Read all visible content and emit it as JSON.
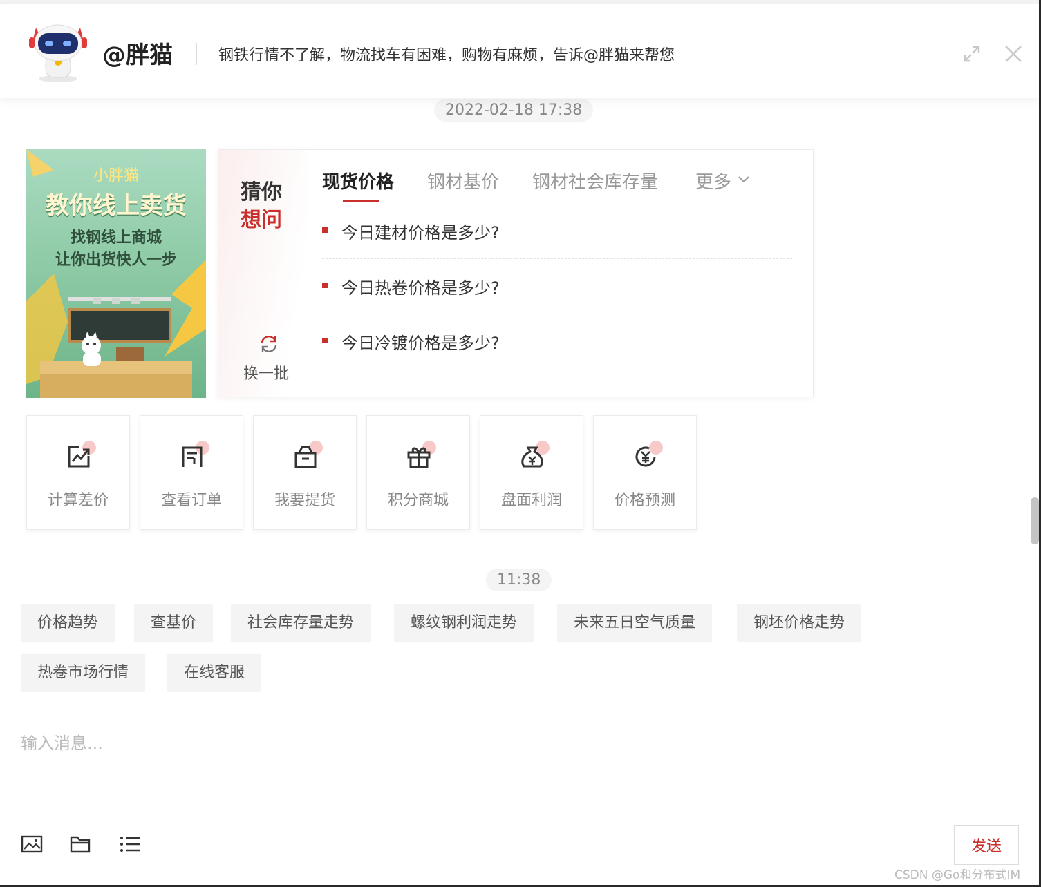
{
  "header": {
    "bot_name": "@胖猫",
    "slogan": "钢铁行情不了解，物流找车有困难，购物有麻烦，告诉@胖猫来帮您"
  },
  "timestamps": [
    "2022-02-18 17:38",
    "11:38"
  ],
  "banner": {
    "small_title": "小胖猫",
    "big_title": "教你线上卖货",
    "line1": "找钢线上商城",
    "line2": "让你出货快人一步"
  },
  "qa_card": {
    "guess_line1": "猜你",
    "guess_line2": "想问",
    "refresh_label": "换一批",
    "tabs": [
      {
        "label": "现货价格",
        "active": true
      },
      {
        "label": "钢材基价",
        "active": false
      },
      {
        "label": "钢材社会库存量",
        "active": false
      },
      {
        "label": "更多",
        "active": false
      }
    ],
    "questions": [
      "今日建材价格是多少?",
      "今日热卷价格是多少?",
      "今日冷镀价格是多少?"
    ]
  },
  "shortcuts": [
    {
      "label": "计算差价",
      "icon": "chart-trend-icon"
    },
    {
      "label": "查看订单",
      "icon": "order-list-icon"
    },
    {
      "label": "我要提货",
      "icon": "package-box-icon"
    },
    {
      "label": "积分商城",
      "icon": "gift-icon"
    },
    {
      "label": "盘面利润",
      "icon": "money-bag-icon"
    },
    {
      "label": "价格预测",
      "icon": "yuan-cycle-icon"
    }
  ],
  "chips": [
    "价格趋势",
    "查基价",
    "社会库存量走势",
    "螺纹钢利润走势",
    "未来五日空气质量",
    "钢坯价格走势",
    "热卷市场行情",
    "在线客服"
  ],
  "composer": {
    "placeholder": "输入消息...",
    "send_label": "发送"
  },
  "watermark": "CSDN @Go和分布式IM",
  "colors": {
    "accent": "#c9302c",
    "chip_bg": "#f4f4f4"
  }
}
